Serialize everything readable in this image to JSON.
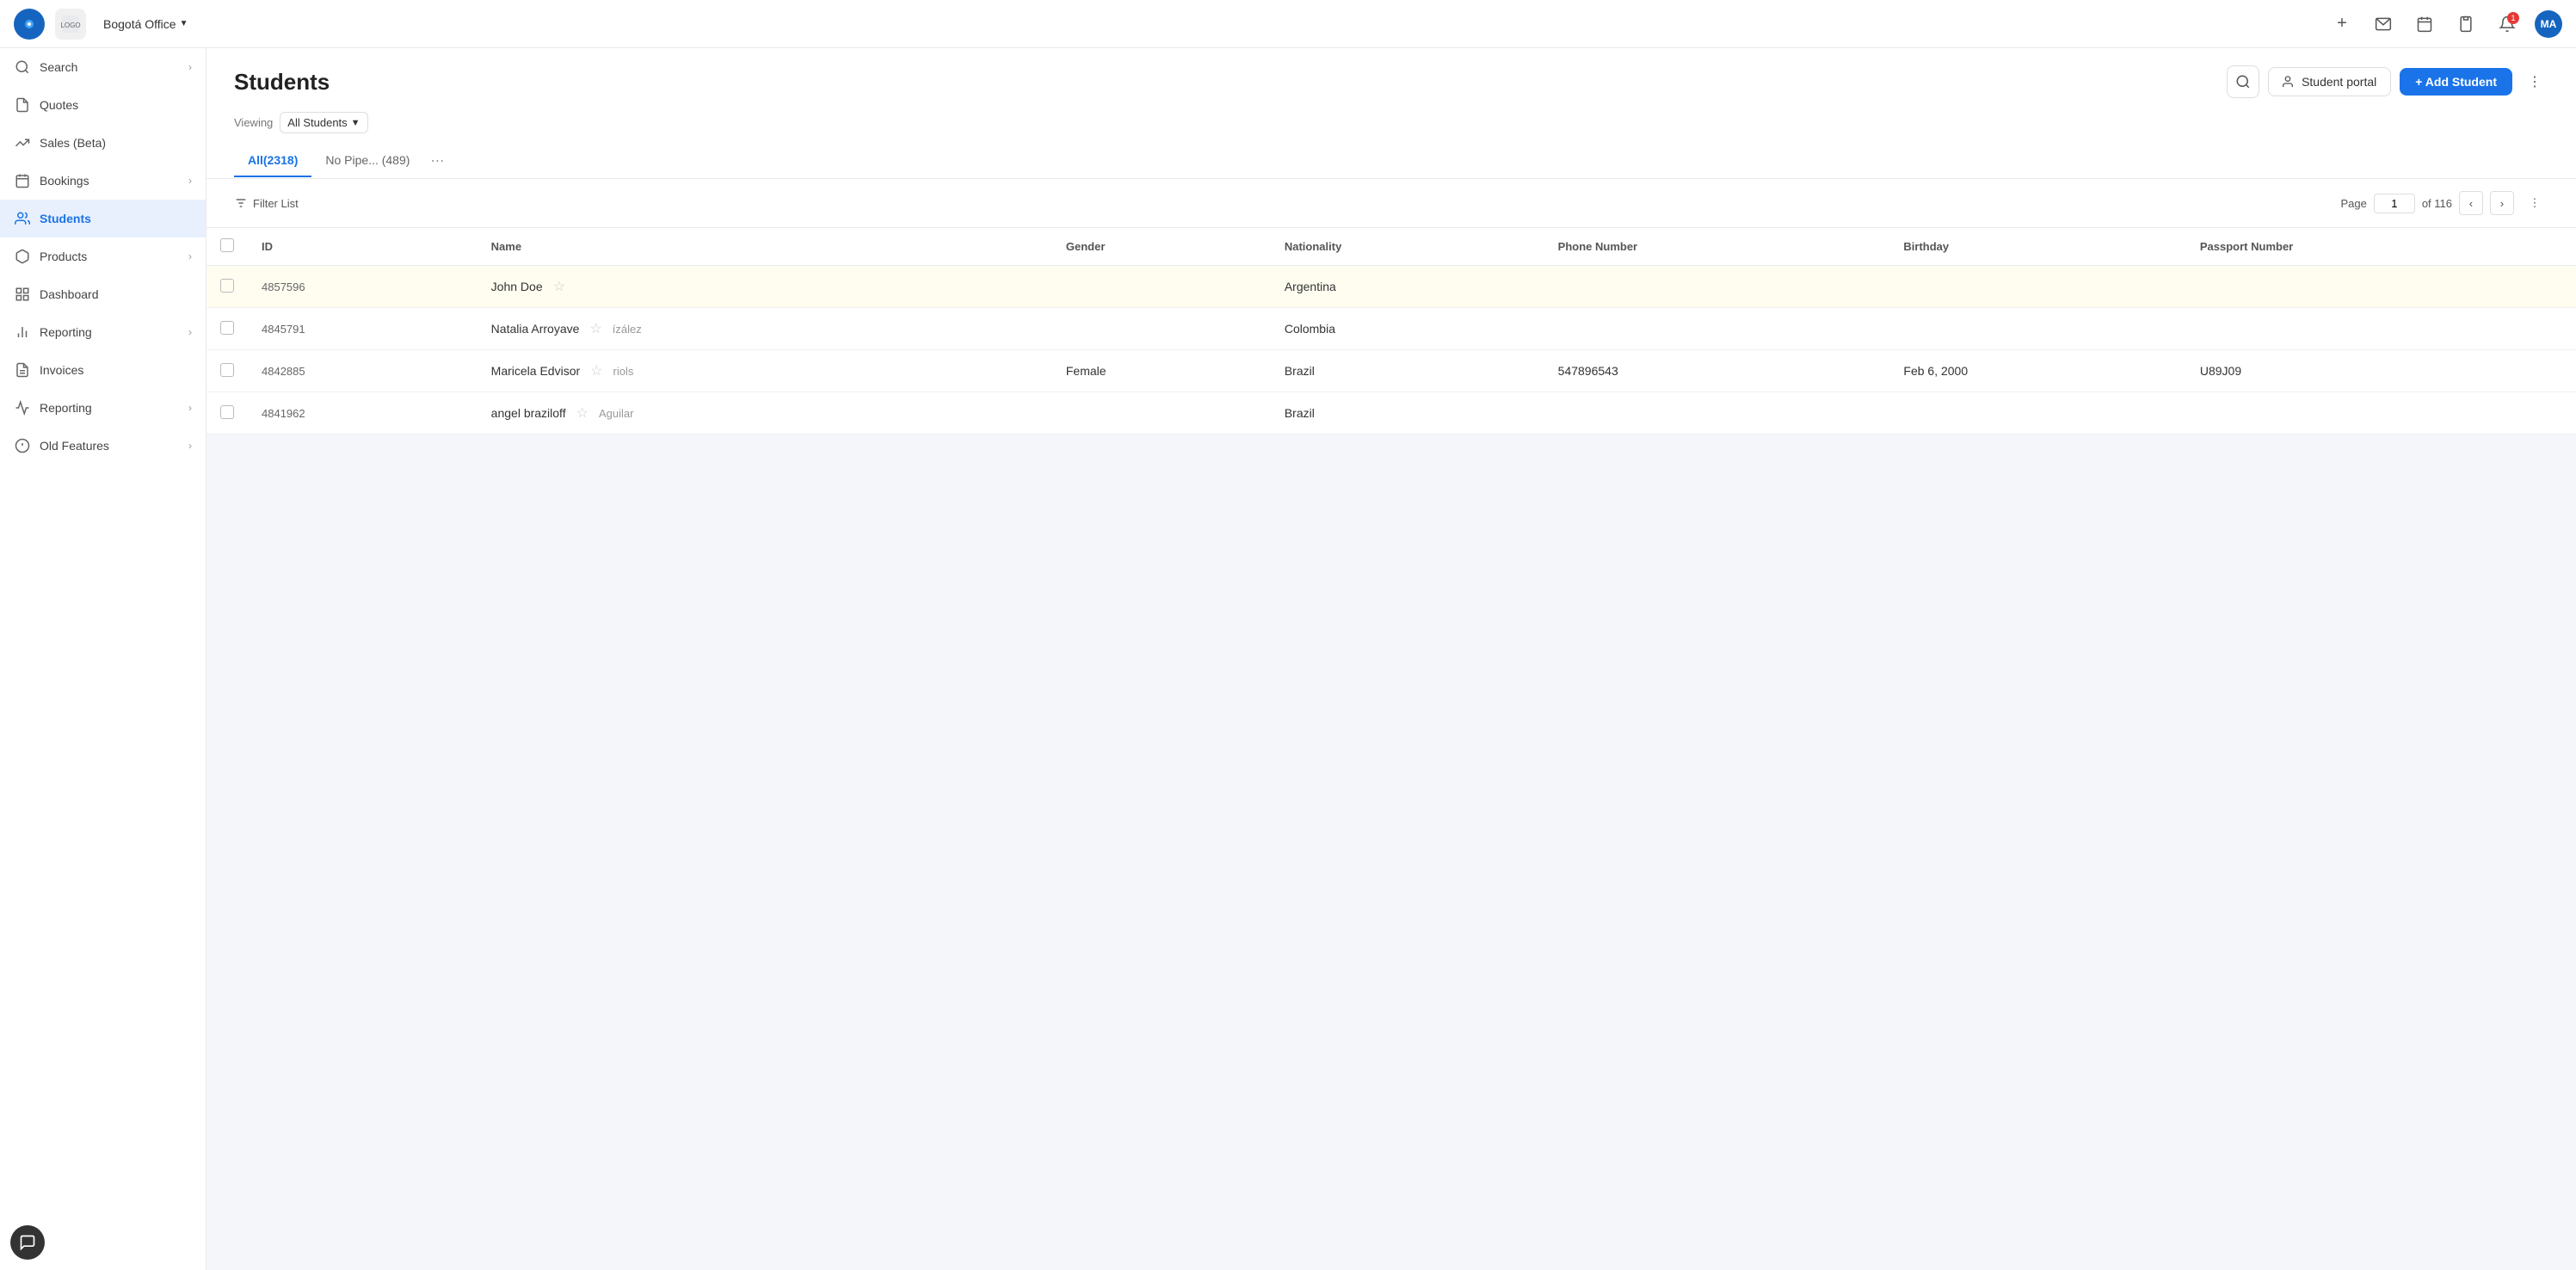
{
  "app": {
    "logo_text": "●",
    "brand_text": "LOGO",
    "office_name": "Bogotá Office",
    "avatar_initials": "MA"
  },
  "topbar": {
    "plus_icon": "+",
    "messages_icon": "✉",
    "calendar_icon": "📅",
    "clipboard_icon": "📋",
    "bell_icon": "🔔",
    "notification_count": "1"
  },
  "sidebar": {
    "items": [
      {
        "id": "search",
        "label": "Search",
        "icon": "🔍",
        "has_arrow": true
      },
      {
        "id": "quotes",
        "label": "Quotes",
        "icon": "📄",
        "has_arrow": false
      },
      {
        "id": "sales",
        "label": "Sales (Beta)",
        "icon": "📈",
        "has_arrow": false
      },
      {
        "id": "bookings",
        "label": "Bookings",
        "icon": "📅",
        "has_arrow": true
      },
      {
        "id": "students",
        "label": "Students",
        "icon": "🎓",
        "has_arrow": false,
        "active": true
      },
      {
        "id": "products",
        "label": "Products",
        "icon": "📦",
        "has_arrow": true
      },
      {
        "id": "dashboard",
        "label": "Dashboard",
        "icon": "📊",
        "has_arrow": false
      },
      {
        "id": "reporting",
        "label": "Reporting",
        "icon": "📉",
        "has_arrow": true
      },
      {
        "id": "invoices",
        "label": "Invoices",
        "icon": "🧾",
        "has_arrow": false
      },
      {
        "id": "old-reporting",
        "label": "Reporting",
        "icon": "📈",
        "has_arrow": true
      },
      {
        "id": "old-features",
        "label": "Old Features",
        "icon": "⭐",
        "has_arrow": true
      }
    ]
  },
  "main": {
    "title": "Students",
    "search_label": "Search",
    "student_portal_label": "Student portal",
    "add_student_label": "+ Add Student",
    "viewing_label": "Viewing",
    "viewing_value": "All Students",
    "tabs": [
      {
        "id": "all",
        "label": "All(2318)",
        "active": true
      },
      {
        "id": "nopipe",
        "label": "No Pipe... (489)",
        "active": false
      }
    ],
    "filter_list_label": "Filter List",
    "page_label": "Page",
    "page_current": "1",
    "page_total": "of 116"
  },
  "table": {
    "columns": [
      {
        "id": "checkbox",
        "label": ""
      },
      {
        "id": "id",
        "label": "ID"
      },
      {
        "id": "name",
        "label": "Name"
      },
      {
        "id": "gender",
        "label": "Gender"
      },
      {
        "id": "nationality",
        "label": "Nationality"
      },
      {
        "id": "phone",
        "label": "Phone Number"
      },
      {
        "id": "birthday",
        "label": "Birthday"
      },
      {
        "id": "passport",
        "label": "Passport Number"
      }
    ],
    "rows": [
      {
        "id": "4857596",
        "name": "John Doe",
        "extra_name": "",
        "gender": "",
        "nationality": "Argentina",
        "phone": "",
        "birthday": "",
        "passport": "",
        "highlighted": true
      },
      {
        "id": "4845791",
        "name": "Natalia Arroyave",
        "extra_name": "ízález",
        "gender": "",
        "nationality": "Colombia",
        "phone": "",
        "birthday": "",
        "passport": ""
      },
      {
        "id": "4842885",
        "name": "Maricela Edvisor",
        "extra_name": "riols",
        "gender": "Female",
        "nationality": "Brazil",
        "phone": "547896543",
        "birthday": "Feb 6, 2000",
        "passport": "U89J09"
      },
      {
        "id": "4841962",
        "name": "angel braziloff",
        "extra_name": "Aguilar",
        "gender": "",
        "nationality": "Brazil",
        "phone": "",
        "birthday": "",
        "passport": ""
      }
    ]
  }
}
